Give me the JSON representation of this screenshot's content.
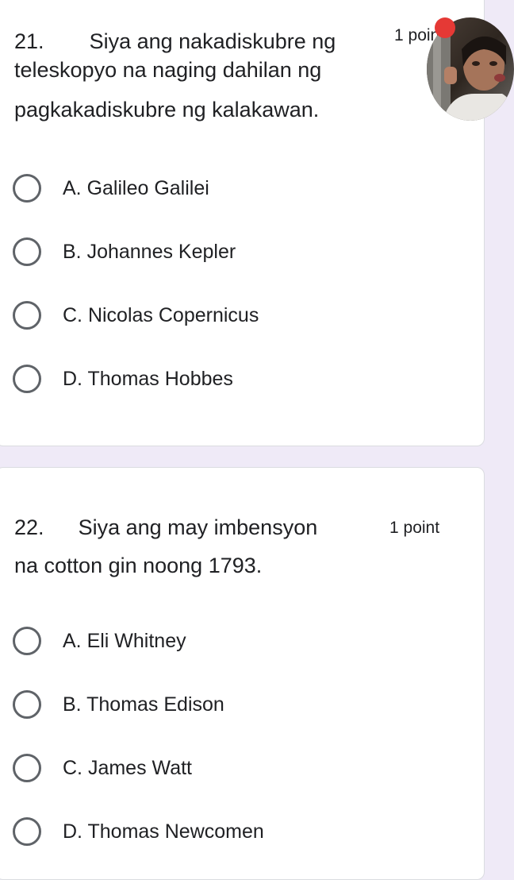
{
  "questions": [
    {
      "number": "21.",
      "text_line1": "Siya ang nakadiskubre ng",
      "text_line2": "teleskopyo na naging dahilan ng",
      "text_line3": "pagkakadiskubre ng kalakawan.",
      "points": "1 point",
      "options": [
        "A. Galileo Galilei",
        "B. Johannes Kepler",
        "C. Nicolas Copernicus",
        "D. Thomas Hobbes"
      ]
    },
    {
      "number": "22.",
      "text_line1": "Siya ang may imbensyon",
      "text_line2": "na cotton gin noong 1793.",
      "points": "1 point",
      "options": [
        "A. Eli Whitney",
        "B. Thomas Edison",
        "C. James Watt",
        "D. Thomas Newcomen"
      ]
    }
  ],
  "colors": {
    "background": "#efeaf7",
    "card": "#ffffff",
    "radio": "#5f6368"
  }
}
